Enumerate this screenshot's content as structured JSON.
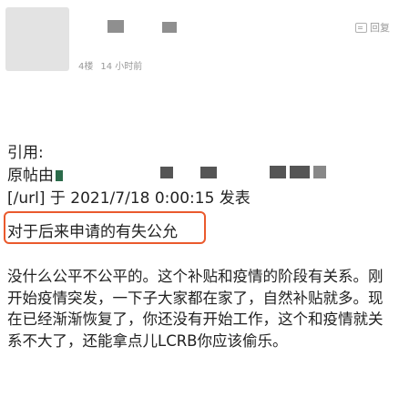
{
  "post": {
    "reply_label": "回复",
    "floor": "4楼",
    "time": "14 小时前"
  },
  "quote": {
    "label": "引用:",
    "author_prefix": "原帖由",
    "url_line": "[/url] 于 2021/7/18 0:00:15 发表",
    "quoted_text": "对于后来申请的有失公允"
  },
  "body": {
    "text": "没什么公平不公平的。这个补贴和疫情的阶段有关系。刚开始疫情突发，一下子大家都在家了，自然补贴就多。现在已经渐渐恢复了，你还没有开始工作，这个和疫情就关系不大了，还能拿点儿LCRB你应该偷乐。"
  }
}
